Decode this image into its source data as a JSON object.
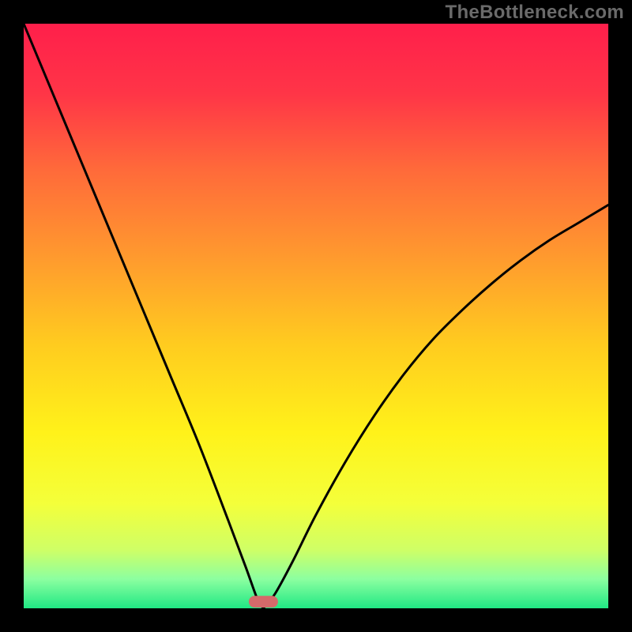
{
  "watermark": "TheBottleneck.com",
  "chart_data": {
    "type": "line",
    "title": "",
    "xlabel": "",
    "ylabel": "",
    "x_range": [
      0,
      100
    ],
    "y_range_percent": [
      0,
      100
    ],
    "curve_minimum_x": 41,
    "marker": {
      "x": 41,
      "width": 5,
      "height": 2,
      "color": "#d46a6a"
    },
    "left": {
      "x": [
        0,
        5,
        10,
        15,
        20,
        25,
        30,
        35,
        38,
        40,
        41
      ],
      "y": [
        100,
        88,
        76,
        64,
        52,
        40,
        28,
        15,
        7,
        1.5,
        0
      ]
    },
    "right": {
      "x": [
        41,
        43,
        46,
        50,
        55,
        60,
        65,
        70,
        75,
        80,
        85,
        90,
        95,
        100
      ],
      "y": [
        0,
        2.5,
        8,
        16,
        25,
        33,
        40,
        46,
        51,
        55.5,
        59.5,
        63,
        66,
        69
      ]
    },
    "background_gradient_stops": [
      {
        "offset": 0,
        "color": "#ff1f4b"
      },
      {
        "offset": 12,
        "color": "#ff3547"
      },
      {
        "offset": 25,
        "color": "#ff6a3a"
      },
      {
        "offset": 40,
        "color": "#ff9a2e"
      },
      {
        "offset": 55,
        "color": "#ffcc1f"
      },
      {
        "offset": 70,
        "color": "#fff21a"
      },
      {
        "offset": 82,
        "color": "#f4ff3a"
      },
      {
        "offset": 90,
        "color": "#cfff66"
      },
      {
        "offset": 95,
        "color": "#8cffa0"
      },
      {
        "offset": 100,
        "color": "#20e884"
      }
    ]
  }
}
